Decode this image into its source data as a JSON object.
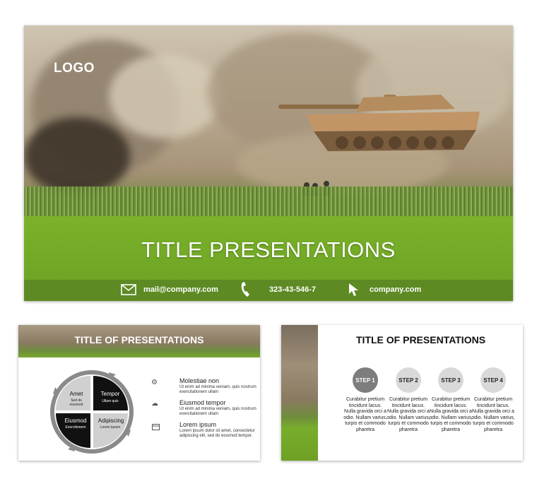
{
  "main": {
    "logo": "LOGO",
    "title": "TITLE PRESENTATIONS",
    "email": "mail@company.com",
    "phone": "323-43-546-7",
    "website": "company.com",
    "icons": [
      "envelope-icon",
      "phone-icon",
      "cursor-icon"
    ]
  },
  "slide2": {
    "title": "TITLE OF PRESENTATIONS",
    "cycle": [
      {
        "label": "Amet",
        "sub": "Sed do eiusmod"
      },
      {
        "label": "Tempor",
        "sub": "Ullam quis"
      },
      {
        "label": "Adipiscing",
        "sub": "Lorem ipsum"
      },
      {
        "label": "Eiusmod",
        "sub": "Exercitionem"
      }
    ],
    "bullets": [
      {
        "icon": "gear-icon",
        "heading": "Molestiae non",
        "text": "Ut enim ad minima veniam, quis nostrum exercitationem ullam"
      },
      {
        "icon": "cloud-icon",
        "heading": "Eiusmod tempor",
        "text": "Ut enim ad minima veniam, quis nostrum exercitationem ullam"
      },
      {
        "icon": "calendar-icon",
        "heading": "Lorem ipsum",
        "text": "Lorem ipsum dolor sit amet, consectetur adipiscing elit, sed do eiusmod tempor."
      }
    ]
  },
  "slide3": {
    "title": "TITLE OF PRESENTATIONS",
    "steps": [
      {
        "label": "STEP 1",
        "text": "Curabitur pretium tincidunt lacus. Nulla gravida orci a odio. Nullam varius, turpis et commodo pharetra"
      },
      {
        "label": "STEP 2",
        "text": "Curabitur pretium tincidunt lacus. Nulla gravida orci a odio. Nullam varius, turpis et commodo pharetra"
      },
      {
        "label": "STEP 3",
        "text": "Curabitur pretium tincidunt lacus. Nulla gravida orci a odio. Nullam varius, turpis et commodo pharetra"
      },
      {
        "label": "STEP 4",
        "text": "Curabitur pretium tincidunt lacus. Nulla gravida orci a odio. Nullam varius, turpis et commodo pharetra"
      }
    ]
  },
  "colors": {
    "grass": "#78ad2c",
    "footer": "#5d8a23",
    "step_active": "#7d7d7d",
    "step_inactive": "#d9d9d9",
    "cycle_dark": "#111111",
    "cycle_light": "#cccccc"
  }
}
